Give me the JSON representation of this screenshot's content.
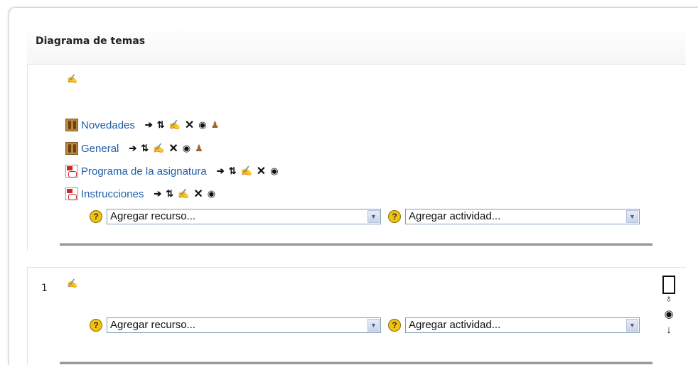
{
  "header": {
    "title": "Diagrama de temas"
  },
  "sections": {
    "topic0": {
      "resources": [
        {
          "type": "forum",
          "label": "Novedades",
          "has_group_icon": true
        },
        {
          "type": "forum",
          "label": "General",
          "has_group_icon": true
        },
        {
          "type": "pdf",
          "label": "Programa de la asignatura",
          "has_group_icon": false
        },
        {
          "type": "pdf",
          "label": "Instrucciones",
          "has_group_icon": false
        }
      ],
      "add_resource": "Agregar recurso...",
      "add_activity": "Agregar actividad..."
    },
    "topic1": {
      "number": "1",
      "add_resource": "Agregar recurso...",
      "add_activity": "Agregar actividad..."
    }
  },
  "icons": {
    "edit": "edit-summary-icon",
    "move": "move-right-icon",
    "reorder": "move-updown-icon",
    "update": "update-icon",
    "delete": "delete-icon",
    "visibility": "eye-icon",
    "group": "group-mode-icon",
    "help": "help-icon",
    "highlight": "highlight-square-icon",
    "light": "lightbulb-icon",
    "down": "arrow-down-icon"
  },
  "colors": {
    "link": "#1f5ea8",
    "help": "#f2c211"
  }
}
